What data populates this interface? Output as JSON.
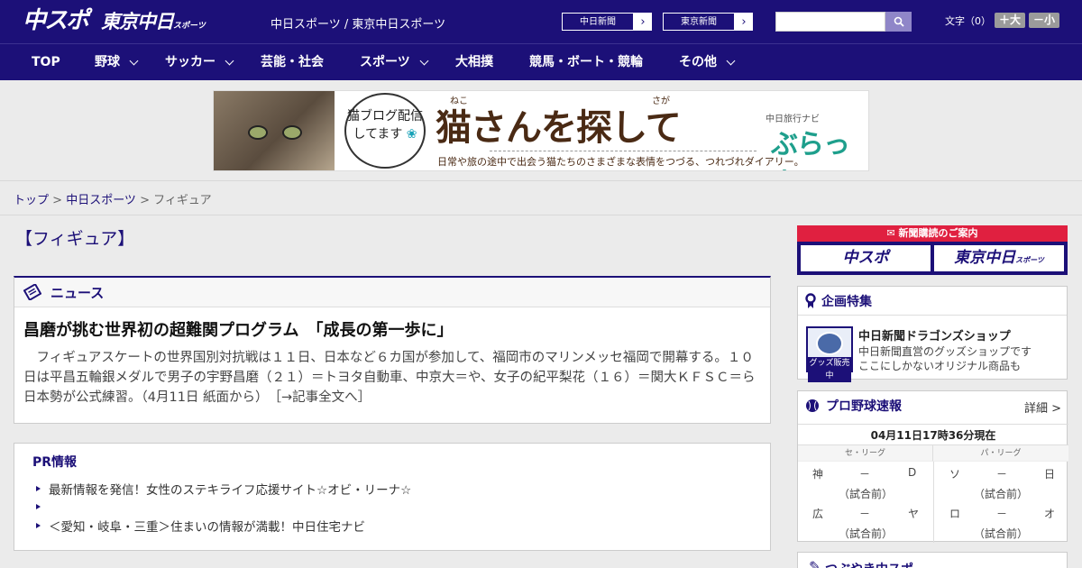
{
  "header": {
    "logo_main": "中スポ",
    "logo_sub": "東京中日",
    "logo_sub_small": "スポーツ",
    "links_text": "中日スポーツ / 東京中日スポーツ",
    "paper1": "中日新聞",
    "paper2": "東京新聞",
    "font_label": "文字（0）",
    "font_up": "＋大",
    "font_down": "－小"
  },
  "nav": [
    {
      "label": "TOP"
    },
    {
      "label": "野球"
    },
    {
      "label": "サッカー"
    },
    {
      "label": "芸能・社会"
    },
    {
      "label": "スポーツ"
    },
    {
      "label": "大相撲"
    },
    {
      "label": "競馬・ボート・競輪"
    },
    {
      "label": "その他"
    }
  ],
  "banner": {
    "bubble": "猫ブログ配信してます",
    "title": "猫さんを探して",
    "ruby1": "ねこ",
    "ruby2": "さが",
    "sub": "日常や旅の途中で出会う猫たちのさまざまな表情をつづる、つれづれダイアリー。",
    "brand_small": "中日旅行ナビ",
    "brand": "ぶらっ人"
  },
  "breadcrumb": {
    "top": "トップ",
    "sep1": " > ",
    "section": "中日スポーツ",
    "sep2": " > ",
    "current": "フィギュア"
  },
  "page_title": "【フィギュア】",
  "news": {
    "header": "ニュース",
    "headline": "昌磨が挑む世界初の超難関プログラム　「成長の第一歩に」",
    "body": "　フィギュアスケートの世界国別対抗戦は１１日、日本など６カ国が参加して、福岡市のマリンメッセ福岡で開幕する。１０日は平昌五輪銀メダルで男子の宇野昌磨（２１）＝トヨタ自動車、中京大＝や、女子の紀平梨花（１６）＝関大ＫＦＳＣ＝ら日本勢が公式練習。（4月11日 紙面から）　［→記事全文へ］"
  },
  "pr": {
    "title": "PR情報",
    "items": [
      "最新情報を発信！女性のステキライフ応援サイト☆オビ・リーナ☆",
      "",
      "＜愛知・岐阜・三重＞住まいの情報が満載！中日住宅ナビ"
    ]
  },
  "subscribe": {
    "header": "新聞購読のご案内",
    "btn1": "中スポ",
    "btn2": "東京中日",
    "btn2_small": "スポーツ"
  },
  "feature": {
    "header": "企画特集",
    "img_label": "グッズ販売中",
    "title": "中日新聞ドラゴンズショップ",
    "desc1": "中日新聞直営のグッズショップです",
    "desc2": "ここにしかないオリジナル商品も"
  },
  "baseball": {
    "header": "プロ野球速報",
    "detail": "詳細 >",
    "date": "04月11日17時36分現在",
    "central": "セ・リーグ",
    "pacific": "パ・リーグ",
    "games": [
      {
        "home": "神",
        "score": "－",
        "away": "D",
        "status": "（試合前）"
      },
      {
        "home": "広",
        "score": "－",
        "away": "ヤ",
        "status": "（試合前）"
      },
      {
        "home": "ソ",
        "score": "－",
        "away": "日",
        "status": "（試合前）"
      },
      {
        "home": "ロ",
        "score": "－",
        "away": "オ",
        "status": "（試合前）"
      }
    ]
  },
  "bottom_box": {
    "title": "つぶやき中スポ"
  },
  "colors": {
    "brand": "#1c1078",
    "accent": "#e02040"
  }
}
